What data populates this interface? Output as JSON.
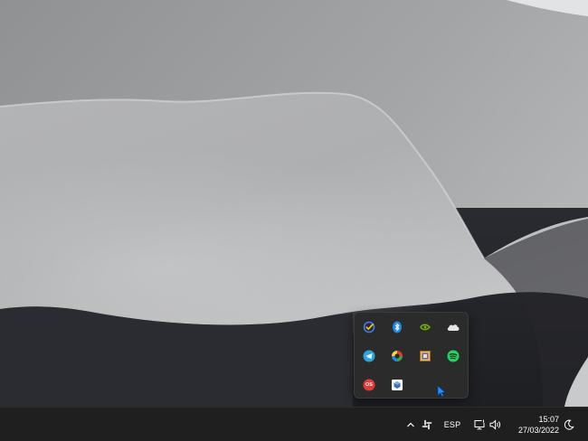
{
  "colors": {
    "taskbar": "#1f1f1f",
    "tray_panel": "#2b2b2b",
    "accent_blue": "#0078d4"
  },
  "tray_overflow": {
    "icons": [
      "todo-checkmark-icon",
      "bluetooth-icon",
      "nvidia-icon",
      "onedrive-cloud-icon",
      "telegram-icon",
      "color-picker-icon",
      "photo-tool-icon",
      "spotify-icon",
      "onedrive-red-os-icon",
      "app-cube-icon"
    ],
    "os_badge_text": "OS"
  },
  "taskbar": {
    "language": "ESP",
    "time": "15:07",
    "date": "27/03/2022",
    "icons": [
      "chevron-up-icon",
      "slack-icon",
      "network-icon",
      "volume-icon",
      "notification-moon-icon"
    ]
  }
}
